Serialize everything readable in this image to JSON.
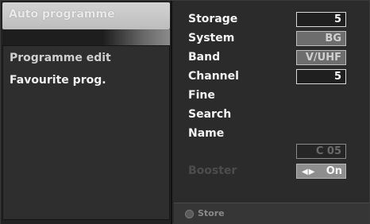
{
  "left_menu": {
    "selected": "Auto programme",
    "items": [
      "Programme edit",
      "Favourite prog."
    ]
  },
  "settings": {
    "storage": {
      "label": "Storage",
      "value": "5"
    },
    "system": {
      "label": "System",
      "value": "BG"
    },
    "band": {
      "label": "Band",
      "value": "V/UHF"
    },
    "channel": {
      "label": "Channel",
      "value": "5"
    },
    "fine": {
      "label": "Fine"
    },
    "search": {
      "label": "Search"
    },
    "name": {
      "label": "Name",
      "value": "C 05"
    },
    "booster": {
      "label": "Booster",
      "arrows": "◀▶",
      "value": "On"
    }
  },
  "footer": {
    "icon": "ok-button-icon",
    "store_label": "Store"
  }
}
